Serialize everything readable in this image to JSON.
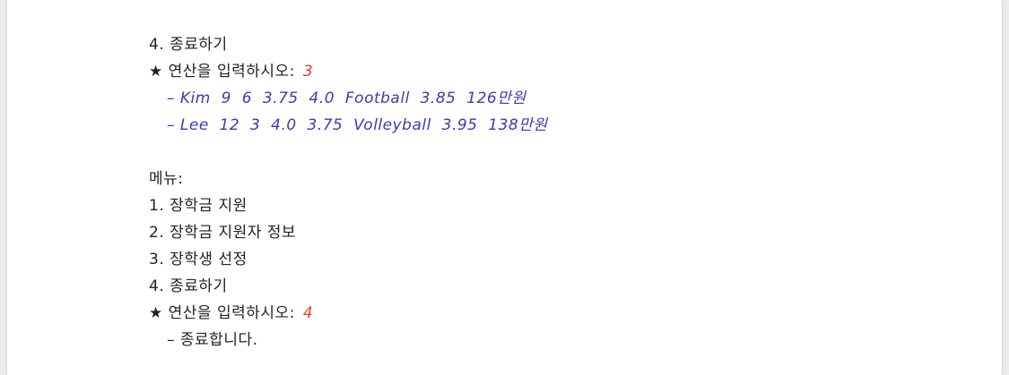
{
  "block1": {
    "menu_item_4": "4. 종료하기",
    "prompt_label": "★ 연산을 입력하시오:",
    "prompt_value": "3",
    "results": [
      "– Kim  9  6  3.75  4.0  Football  3.85  126만원",
      "– Lee  12  3  4.0  3.75  Volleyball  3.95  138만원"
    ]
  },
  "block2": {
    "menu_title": "메뉴:",
    "menu_items": [
      "1. 장학금 지원",
      "2. 장학금 지원자 정보",
      "3. 장학생 선정",
      "4. 종료하기"
    ],
    "prompt_label": "★ 연산을 입력하시오:",
    "prompt_value": "4",
    "exit_message": "– 종료합니다."
  },
  "colors": {
    "input_value": "#e0412a",
    "result_text": "#3b3bb4",
    "body_text": "#222222"
  }
}
